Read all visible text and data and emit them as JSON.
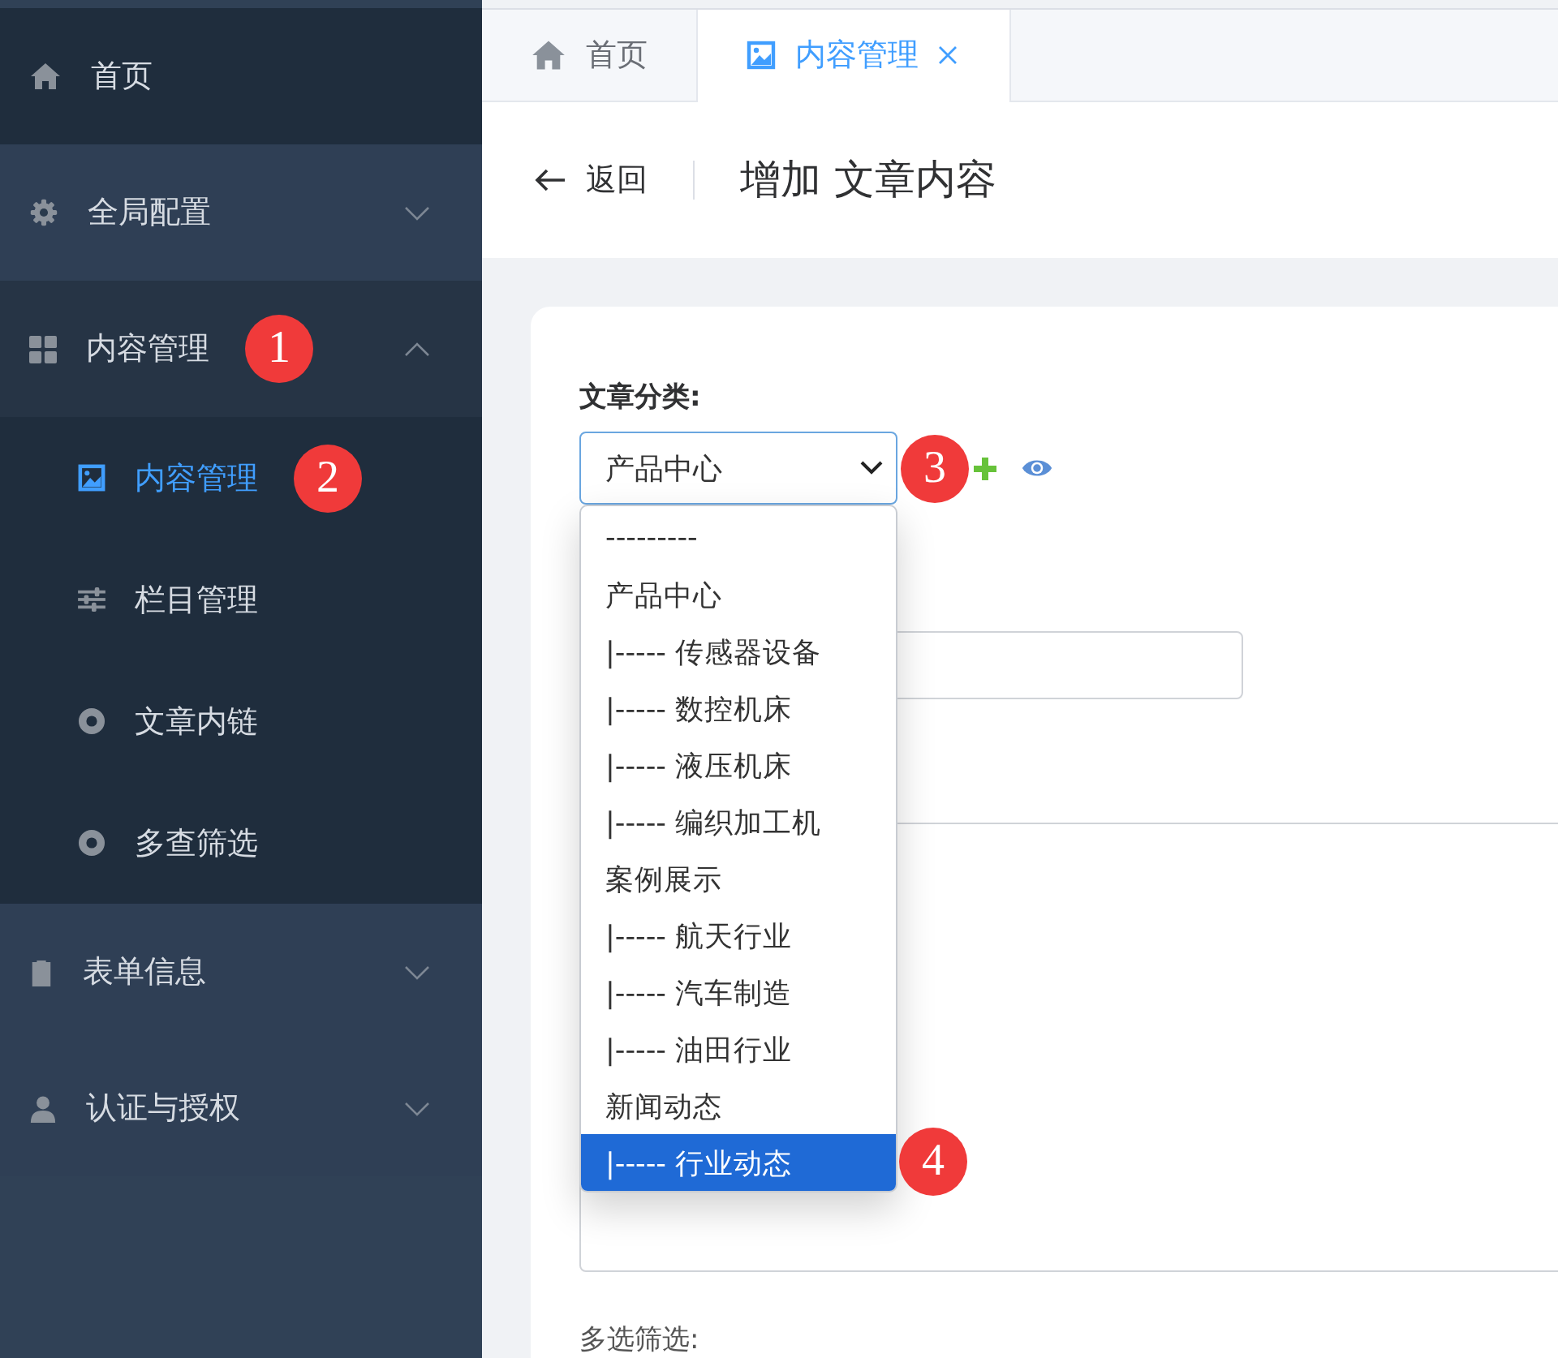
{
  "sidebar": {
    "items": [
      {
        "label": "首页"
      },
      {
        "label": "全局配置",
        "expanded": false
      },
      {
        "label": "内容管理",
        "expanded": true,
        "badge": "1",
        "children": [
          {
            "label": "内容管理",
            "selected": true,
            "badge": "2"
          },
          {
            "label": "栏目管理",
            "selected": false
          },
          {
            "label": "文章内链",
            "selected": false
          },
          {
            "label": "多查筛选",
            "selected": false
          }
        ]
      },
      {
        "label": "表单信息",
        "expanded": false
      },
      {
        "label": "认证与授权",
        "expanded": false
      }
    ]
  },
  "tabs": [
    {
      "label": "首页",
      "selected": false,
      "closable": false
    },
    {
      "label": "内容管理",
      "selected": true,
      "closable": true
    }
  ],
  "header": {
    "back": "返回",
    "title": "增加 文章内容"
  },
  "form": {
    "category_label": "文章分类:",
    "select": {
      "value": "产品中心",
      "open": true,
      "badge": "3"
    },
    "options": [
      {
        "label": "---------",
        "selected": false
      },
      {
        "label": "产品中心",
        "selected": false
      },
      {
        "label": "|----- 传感器设备",
        "selected": false
      },
      {
        "label": "|----- 数控机床",
        "selected": false
      },
      {
        "label": "|----- 液压机床",
        "selected": false
      },
      {
        "label": "|----- 编织加工机",
        "selected": false
      },
      {
        "label": "案例展示",
        "selected": false
      },
      {
        "label": "|----- 航天行业",
        "selected": false
      },
      {
        "label": "|----- 汽车制造",
        "selected": false
      },
      {
        "label": "|----- 油田行业",
        "selected": false
      },
      {
        "label": "新闻动态",
        "selected": false
      },
      {
        "label": "|----- 行业动态",
        "selected": true,
        "badge": "4"
      }
    ],
    "bottom_label": "多选筛选:"
  }
}
